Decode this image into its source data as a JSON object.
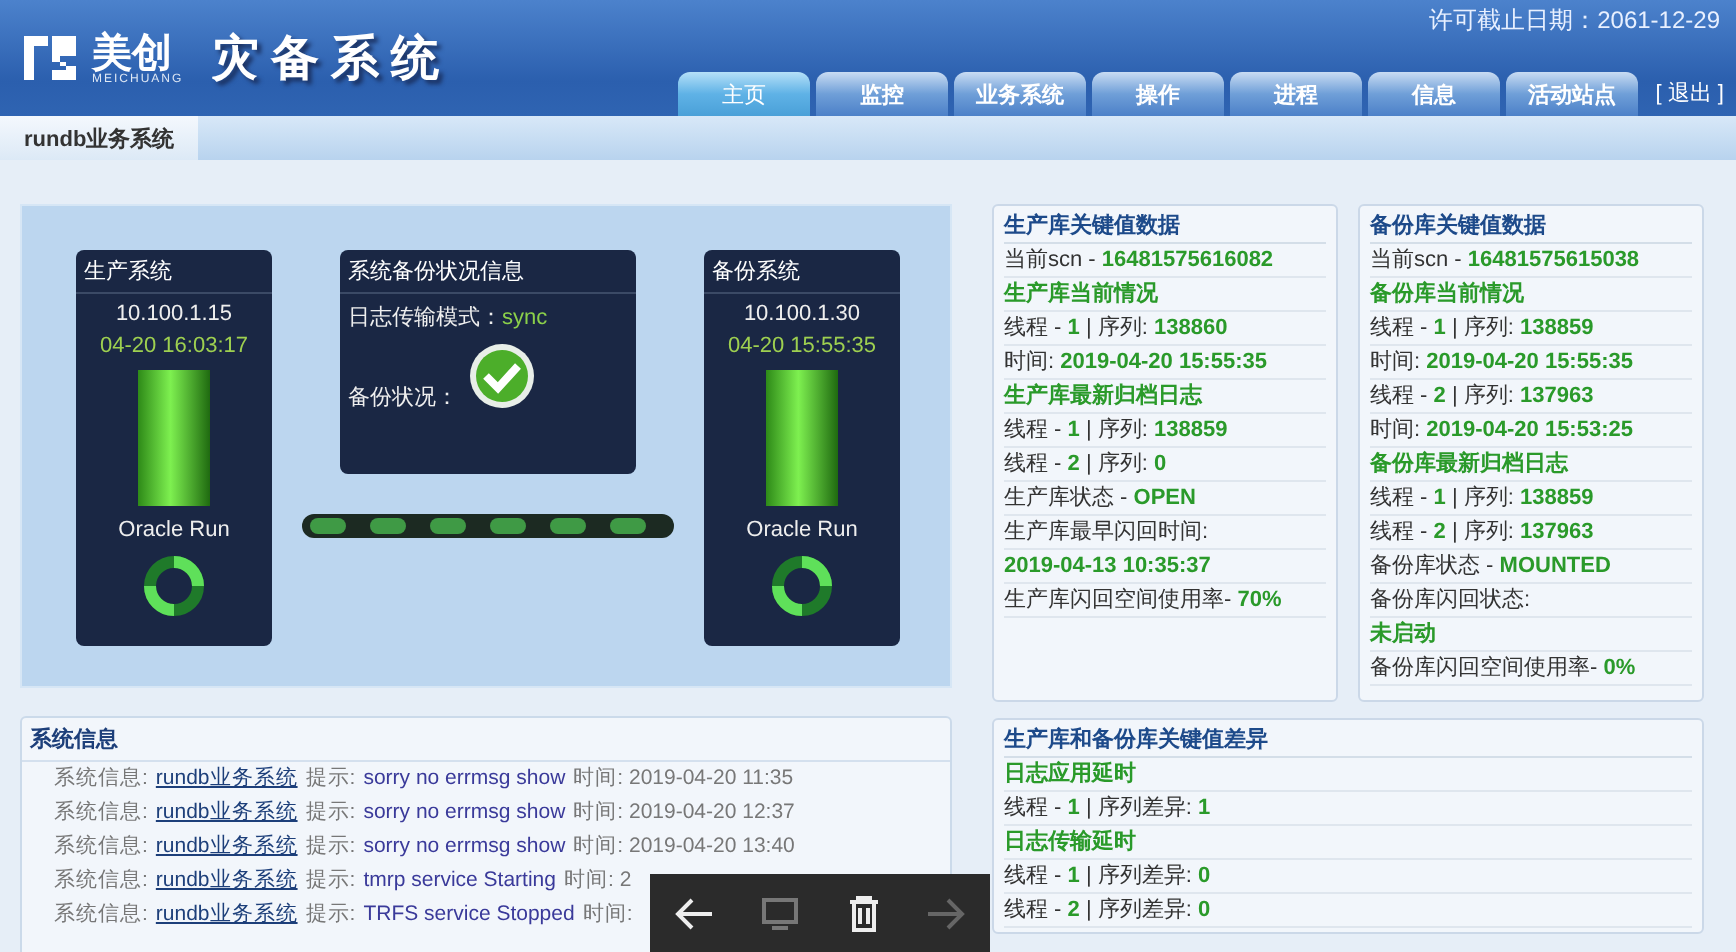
{
  "header": {
    "logo_text": "美创",
    "logo_sub": "MEICHUANG",
    "title": "灾备系统",
    "license": "许可截止日期：2061-12-29",
    "logout": "[ 退出 ]",
    "tabs": [
      {
        "label": "主页",
        "selected": true
      },
      {
        "label": "监控",
        "selected": false
      },
      {
        "label": "业务系统",
        "selected": false
      },
      {
        "label": "操作",
        "selected": false
      },
      {
        "label": "进程",
        "selected": false
      },
      {
        "label": "信息",
        "selected": false
      },
      {
        "label": "活动站点",
        "selected": false
      }
    ]
  },
  "breadcrumb": "rundb业务系统",
  "systems": {
    "production": {
      "title": "生产系统",
      "ip": "10.100.1.15",
      "time": "04-20 16:03:17",
      "status": "Oracle Run"
    },
    "backup": {
      "title": "备份系统",
      "ip": "10.100.1.30",
      "time": "04-20 15:55:35",
      "status": "Oracle Run"
    },
    "center": {
      "title": "系统备份状况信息",
      "mode_label": "日志传输模式：",
      "mode": "sync",
      "status_label": "备份状况：",
      "ok": true
    }
  },
  "cards": [
    {
      "title": "生产库关键值数据",
      "lines": [
        {
          "kind": "text",
          "text": "当前scn - **16481575616082**"
        },
        {
          "kind": "heading",
          "text": "生产库当前情况"
        },
        {
          "kind": "text",
          "text": "线程 - **1** | 序列: **138860**"
        },
        {
          "kind": "text",
          "text": "时间: **2019-04-20 15:55:35**"
        },
        {
          "kind": "heading",
          "text": "生产库最新归档日志"
        },
        {
          "kind": "text",
          "text": "线程 - **1** | 序列: **138859**"
        },
        {
          "kind": "text",
          "text": "线程 - **2** | 序列: **0**"
        },
        {
          "kind": "text",
          "text": "生产库状态 - **OPEN**"
        },
        {
          "kind": "text",
          "text": "生产库最早闪回时间:"
        },
        {
          "kind": "value",
          "text": "2019-04-13 10:35:37"
        },
        {
          "kind": "text",
          "text": "生产库闪回空间使用率- **70%**"
        }
      ]
    },
    {
      "title": "备份库关键值数据",
      "lines": [
        {
          "kind": "text",
          "text": "当前scn - **16481575615038**"
        },
        {
          "kind": "heading",
          "text": "备份库当前情况"
        },
        {
          "kind": "text",
          "text": "线程 - **1** | 序列: **138859**"
        },
        {
          "kind": "text",
          "text": "时间: **2019-04-20 15:55:35**"
        },
        {
          "kind": "text",
          "text": "线程 - **2** | 序列: **137963**"
        },
        {
          "kind": "text",
          "text": "时间: **2019-04-20 15:53:25**"
        },
        {
          "kind": "heading",
          "text": "备份库最新归档日志"
        },
        {
          "kind": "text",
          "text": "线程 - **1** | 序列: **138859**"
        },
        {
          "kind": "text",
          "text": "线程 - **2** | 序列: **137963**"
        },
        {
          "kind": "text",
          "text": "备份库状态 - **MOUNTED**"
        },
        {
          "kind": "text",
          "text": "备份库闪回状态:"
        },
        {
          "kind": "value",
          "text": "未启动"
        },
        {
          "kind": "text",
          "text": "备份库闪回空间使用率- **0%**"
        }
      ]
    }
  ],
  "messages": {
    "title": "系统信息",
    "rows": [
      {
        "label": "系统信息:",
        "system": "rundb业务系统",
        "hint_label": "提示:",
        "hint": "sorry no errmsg show",
        "time": "时间: 2019-04-20 11:35"
      },
      {
        "label": "系统信息:",
        "system": "rundb业务系统",
        "hint_label": "提示:",
        "hint": "sorry no errmsg show",
        "time": "时间: 2019-04-20 12:37"
      },
      {
        "label": "系统信息:",
        "system": "rundb业务系统",
        "hint_label": "提示:",
        "hint": "sorry no errmsg show",
        "time": "时间: 2019-04-20 13:40"
      },
      {
        "label": "系统信息:",
        "system": "rundb业务系统",
        "hint_label": "提示:",
        "hint": "tmrp service Starting",
        "time": "时间: 2"
      },
      {
        "label": "系统信息:",
        "system": "rundb业务系统",
        "hint_label": "提示:",
        "hint": "TRFS service Stopped",
        "time": "时间:"
      }
    ]
  },
  "diff": {
    "title": "生产库和备份库关键值差异",
    "lines": [
      {
        "kind": "heading",
        "text": "日志应用延时"
      },
      {
        "kind": "text",
        "text": "线程 - **1** | 序列差异: **1**"
      },
      {
        "kind": "heading",
        "text": "日志传输延时"
      },
      {
        "kind": "text",
        "text": "线程 - **1** | 序列差异: **0**"
      },
      {
        "kind": "text",
        "text": "线程 - **2** | 序列差异: **0**"
      }
    ]
  }
}
